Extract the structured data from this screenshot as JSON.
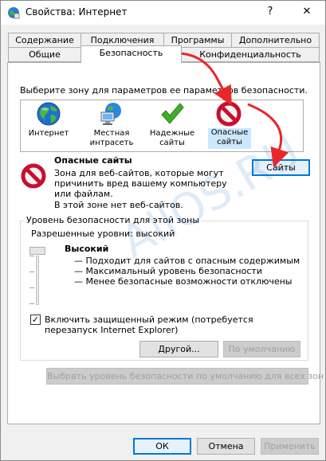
{
  "window": {
    "title": "Свойства: Интернет",
    "help_glyph": "?",
    "close_glyph": "✕"
  },
  "tabs": {
    "row1": [
      "Содержание",
      "Подключения",
      "Программы",
      "Дополнительно"
    ],
    "row2": [
      "Общие",
      "Безопасность",
      "Конфиденциальность"
    ],
    "active": "Безопасность"
  },
  "zones": {
    "prompt": "Выберите зону для параметров ее параметров безопасности.",
    "items": [
      {
        "label": "Интернет",
        "icon": "globe-icon"
      },
      {
        "label": "Местная интрасеть",
        "icon": "intranet-icon"
      },
      {
        "label": "Надежные сайты",
        "icon": "checkmark-icon"
      },
      {
        "label": "Опасные сайты",
        "icon": "restricted-icon",
        "selected": true
      }
    ]
  },
  "selected_zone": {
    "title": "Опасные сайты",
    "description": "Зона для веб-сайтов, которые могут причинить вред вашему компьютеру или файлам.",
    "empty_note": "В этой зоне нет веб-сайтов.",
    "sites_button": "Сайты"
  },
  "security_level": {
    "group_title": "Уровень безопасности для этой зоны",
    "allowed_levels": "Разрешенные уровни: высокий",
    "level_name": "Высокий",
    "bullets": [
      "— Подходит для сайтов с опасным содержимым",
      "— Максимальный уровень безопасности",
      "— Менее безопасные возможности отключены"
    ],
    "protected_mode_checked": true,
    "protected_mode_label": "Включить защищенный режим (потребуется перезапуск Internet Explorer)",
    "custom_button": "Другой...",
    "default_button": "По умолчанию",
    "reset_all_button": "Выбрать уровень безопасности по умолчанию для всех зон"
  },
  "footer": {
    "ok": "ОК",
    "cancel": "Отмена",
    "apply": "Применить"
  },
  "annotations": {
    "watermark": "AllOS.RU",
    "arrow_color": "#e8272a"
  },
  "colors": {
    "focus_blue": "#0078d7",
    "selected_zone_bg": "#cce8ff",
    "restricted_red": "#c8102e",
    "trusted_green": "#3fae2a"
  }
}
